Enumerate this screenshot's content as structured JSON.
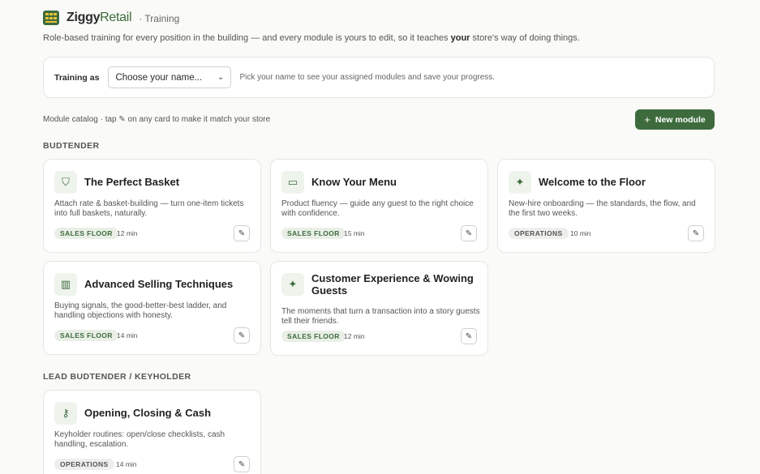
{
  "brand": {
    "name_part1": "Ziggy",
    "name_part2": "Retail",
    "subtitle": "· Training"
  },
  "tagline": {
    "before": "Role-based training for every position in the building — and every module is yours to edit, so it teaches ",
    "bold": "your",
    "after": " store's way of doing things."
  },
  "training": {
    "label": "Training as",
    "select_value": "Choose your name...",
    "hint": "Pick your name to see your assigned modules and save your progress."
  },
  "catalog": {
    "text": "Module catalog · tap ✎ on any card to make it match your store",
    "new_button": "New module"
  },
  "sections": [
    {
      "title": "BUDTENDER"
    },
    {
      "title": "LEAD BUDTENDER / KEYHOLDER"
    }
  ],
  "cards": [
    {
      "icon": "basket-icon",
      "glyph": "⛉",
      "title": "The Perfect Basket",
      "desc": "Attach rate & basket-building — turn one-item tickets into full baskets, naturally.",
      "badge": "SALES FLOOR",
      "mins": "12 min"
    },
    {
      "icon": "book-icon",
      "glyph": "▭",
      "title": "Know Your Menu",
      "desc": "Product fluency — guide any guest to the right choice with confidence.",
      "badge": "SALES FLOOR",
      "mins": "15 min"
    },
    {
      "icon": "sparkle-icon",
      "glyph": "✦",
      "title": "Welcome to the Floor",
      "desc": "New-hire onboarding — the standards, the flow, and the first two weeks.",
      "badge": "OPERATIONS",
      "mins": "10 min"
    },
    {
      "icon": "bar-chart-icon",
      "glyph": "▥",
      "title": "Advanced Selling Techniques",
      "desc": "Buying signals, the good-better-best ladder, and handling objections with honesty.",
      "badge": "SALES FLOOR",
      "mins": "14 min"
    },
    {
      "icon": "sparkle-icon",
      "glyph": "✦",
      "title": "Customer Experience & Wowing Guests",
      "desc": "The moments that turn a transaction into a story guests tell their friends.",
      "badge": "SALES FLOOR",
      "mins": "12 min"
    },
    {
      "icon": "key-icon",
      "glyph": "⚷",
      "title": "Opening, Closing & Cash",
      "desc": "Keyholder routines: open/close checklists, cash handling, escalation.",
      "badge": "OPERATIONS",
      "mins": "14 min"
    }
  ],
  "colors": {
    "accent": "#3d6b3d",
    "badge_bg": "#e9efe6"
  }
}
